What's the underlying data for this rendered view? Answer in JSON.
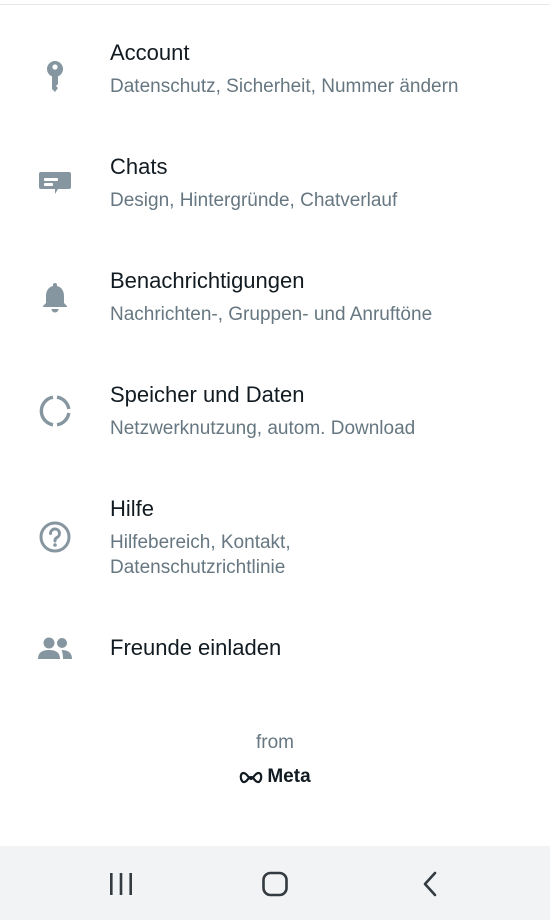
{
  "settings": {
    "items": [
      {
        "id": "account",
        "icon": "key-icon",
        "title": "Account",
        "subtitle": "Datenschutz, Sicherheit, Nummer ändern"
      },
      {
        "id": "chats",
        "icon": "chat-icon",
        "title": "Chats",
        "subtitle": "Design, Hintergründe, Chatverlauf"
      },
      {
        "id": "notifications",
        "icon": "bell-icon",
        "title": "Benachrichtigungen",
        "subtitle": "Nachrichten-, Gruppen- und Anruftöne"
      },
      {
        "id": "storage",
        "icon": "data-usage-icon",
        "title": "Speicher und Daten",
        "subtitle": "Netzwerknutzung, autom. Download"
      },
      {
        "id": "help",
        "icon": "help-icon",
        "title": "Hilfe",
        "subtitle": "Hilfebereich, Kontakt, Datenschutzrichtlinie"
      },
      {
        "id": "invite",
        "icon": "people-icon",
        "title": "Freunde einladen",
        "subtitle": ""
      }
    ]
  },
  "footer": {
    "from_label": "from",
    "brand": "Meta"
  },
  "navigation": {
    "recents": "recents-icon",
    "home": "home-icon",
    "back": "back-icon"
  },
  "colors": {
    "icon": "#8696a0",
    "title": "#111b21",
    "subtitle": "#667781",
    "nav_bar": "#f2f3f5"
  }
}
